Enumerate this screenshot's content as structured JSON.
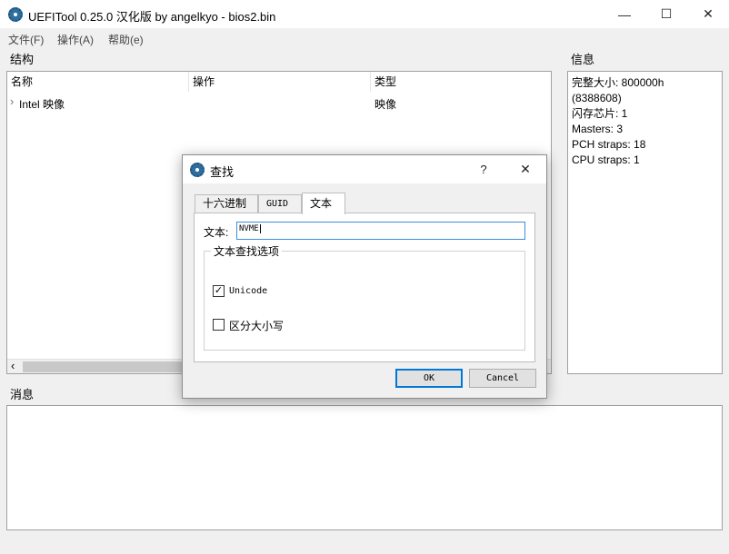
{
  "window": {
    "title": "UEFITool 0.25.0 汉化版 by angelkyo - bios2.bin",
    "minimize_glyph": "—",
    "maximize_glyph": "☐",
    "close_glyph": "✕"
  },
  "menu": [
    "文件(F)",
    "操作(A)",
    "帮助(e)"
  ],
  "structure": {
    "label": "结构",
    "columns": [
      "名称",
      "操作",
      "类型"
    ],
    "rows": [
      {
        "expander": "›",
        "name": "Intel 映像",
        "action": "",
        "type": "映像"
      }
    ],
    "scroll_left_glyph": "‹"
  },
  "info": {
    "label": "信息",
    "lines": [
      "完整大小: 800000h",
      "(8388608)",
      "闪存芯片: 1",
      "Masters: 3",
      "PCH straps: 18",
      "CPU straps: 1"
    ]
  },
  "messages": {
    "label": "消息"
  },
  "dialog": {
    "title": "查找",
    "help_glyph": "?",
    "close_glyph": "✕",
    "tabs": [
      "十六进制",
      "GUID",
      "文本"
    ],
    "active_tab": "文本",
    "text_label": "文本:",
    "text_value": "NVME",
    "options_group": "文本查找选项",
    "unicode_label": "Unicode",
    "unicode_checked": true,
    "case_label": "区分大小写",
    "case_checked": false,
    "ok_label": "OK",
    "cancel_label": "Cancel"
  }
}
